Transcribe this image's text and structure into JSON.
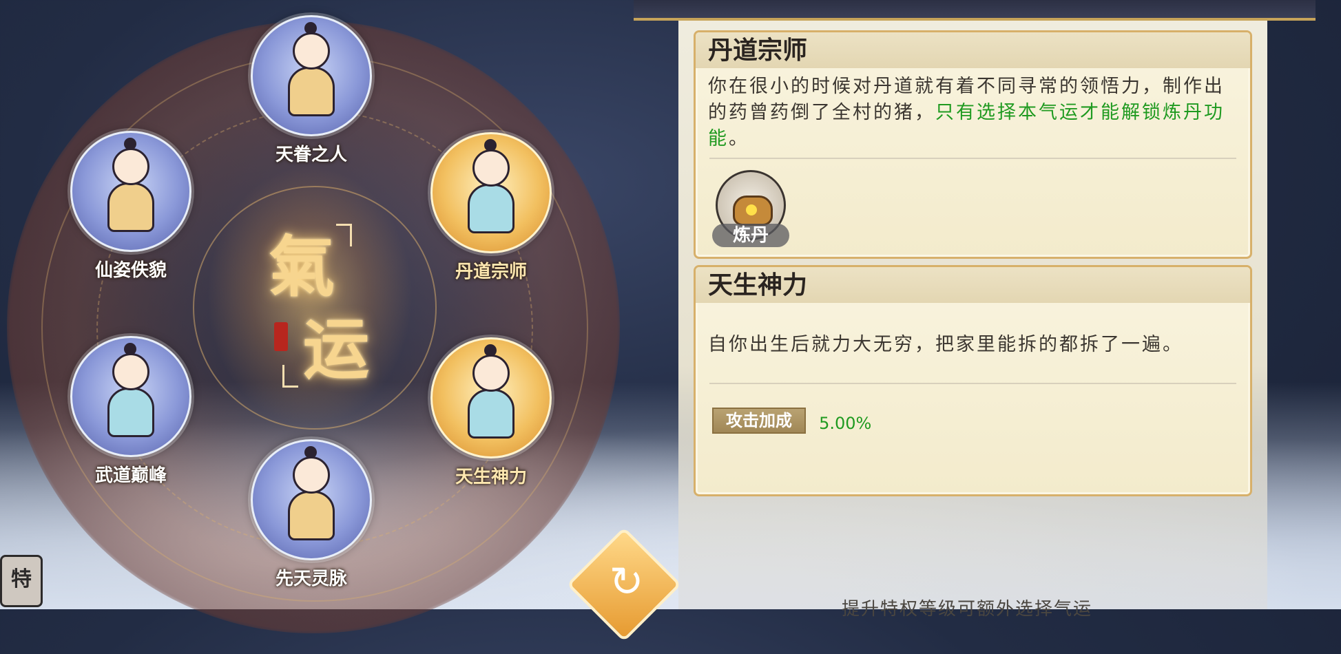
{
  "center_title": {
    "char1": "氣",
    "char2": "运"
  },
  "nodes": [
    {
      "label": "天眷之人",
      "style": "blue"
    },
    {
      "label": "仙姿佚貌",
      "style": "blue"
    },
    {
      "label": "丹道宗师",
      "style": "gold",
      "selected": true
    },
    {
      "label": "武道巅峰",
      "style": "blue"
    },
    {
      "label": "天生神力",
      "style": "gold",
      "selected": true
    },
    {
      "label": "先天灵脉",
      "style": "blue"
    }
  ],
  "badge_text": "特",
  "refresh_icon": "↻",
  "cards": [
    {
      "title": "丹道宗师",
      "desc_normal": "你在很小的时候对丹道就有着不同寻常的领悟力，制作出的药曾药倒了全村的猪，",
      "desc_highlight": "只有选择本气运才能解锁炼丹功能",
      "desc_end": "。",
      "feature": {
        "name": "炼丹",
        "icon": "alchemy-cauldron-icon"
      }
    },
    {
      "title": "天生神力",
      "desc": "自你出生后就力大无穷，把家里能拆的都拆了一遍。",
      "stat": {
        "name": "攻击加成",
        "value": "5.00%"
      }
    }
  ],
  "hint": "提升特权等级可额外选择气运",
  "colors": {
    "highlight": "#1f9a20",
    "card_border": "#d7b06a",
    "gold": "#f2c060"
  }
}
